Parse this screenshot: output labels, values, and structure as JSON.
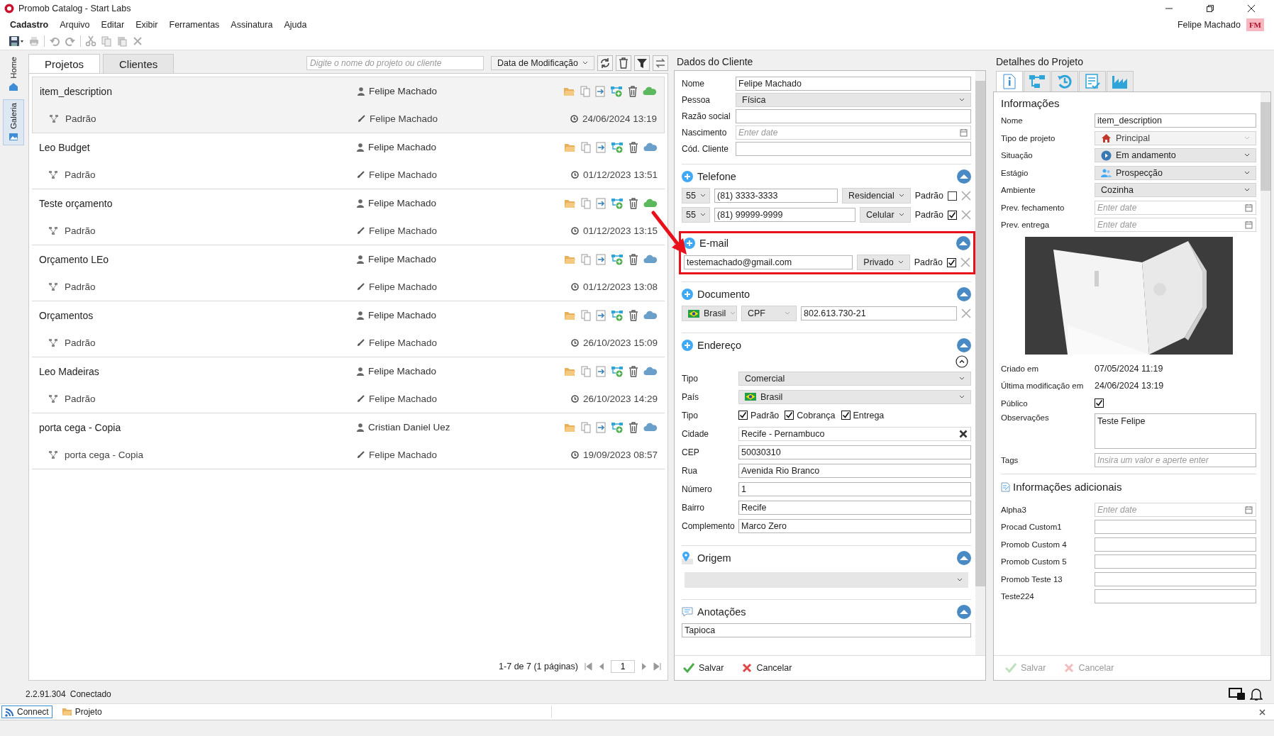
{
  "window": {
    "title": "Promob Catalog - Start Labs"
  },
  "menu": [
    {
      "label": "Cadastro",
      "selected": true
    },
    {
      "label": "Arquivo",
      "selected": false
    },
    {
      "label": "Editar",
      "selected": false
    },
    {
      "label": "Exibir",
      "selected": false
    },
    {
      "label": "Ferramentas",
      "selected": false
    },
    {
      "label": "Assinatura",
      "selected": false
    },
    {
      "label": "Ajuda",
      "selected": false
    }
  ],
  "user": {
    "name": "Felipe Machado",
    "initials": "FM"
  },
  "side_tabs": [
    {
      "label": "Home",
      "selected": false
    },
    {
      "label": "Galeria",
      "selected": true
    }
  ],
  "projects": {
    "tabs": [
      {
        "label": "Projetos",
        "selected": true
      },
      {
        "label": "Clientes",
        "selected": false
      }
    ],
    "search": {
      "placeholder": "Digite o nome do projeto ou cliente"
    },
    "sort": "Data de Modificação",
    "rows": [
      {
        "name": "item_description",
        "owner": "Felipe Machado",
        "version": "Padrão",
        "editor": "Felipe Machado",
        "date": "24/06/2024 13:19",
        "synced": true,
        "selected": true
      },
      {
        "name": "Leo Budget",
        "owner": "Felipe Machado",
        "version": "Padrão",
        "editor": "Felipe Machado",
        "date": "01/12/2023 13:51",
        "synced": false,
        "selected": false
      },
      {
        "name": "Teste orçamento",
        "owner": "Felipe Machado",
        "version": "Padrão",
        "editor": "Felipe Machado",
        "date": "01/12/2023 13:15",
        "synced": true,
        "selected": false
      },
      {
        "name": "Orçamento LEo",
        "owner": "Felipe Machado",
        "version": "Padrão",
        "editor": "Felipe Machado",
        "date": "01/12/2023 13:08",
        "synced": false,
        "selected": false
      },
      {
        "name": "Orçamentos",
        "owner": "Felipe Machado",
        "version": "Padrão",
        "editor": "Felipe Machado",
        "date": "26/10/2023 15:09",
        "synced": false,
        "selected": false
      },
      {
        "name": "Leo Madeiras",
        "owner": "Felipe Machado",
        "version": "Padrão",
        "editor": "Felipe Machado",
        "date": "26/10/2023 14:29",
        "synced": false,
        "selected": false
      },
      {
        "name": "porta cega - Copia",
        "owner": "Cristian Daniel Uez",
        "version": "porta cega - Copia",
        "editor": "Felipe Machado",
        "date": "19/09/2023 08:57",
        "synced": false,
        "selected": false
      }
    ],
    "pagination": {
      "summary": "1-7 de 7 (1 páginas)",
      "page": "1"
    }
  },
  "client": {
    "title": "Dados do Cliente",
    "fields": [
      {
        "label": "Nome",
        "kind": "text",
        "value": "Felipe Machado"
      },
      {
        "label": "Pessoa",
        "kind": "select",
        "value": "Física"
      },
      {
        "label": "Razão social",
        "kind": "text"
      },
      {
        "label": "Nascimento",
        "kind": "date",
        "placeholder": "Enter date"
      },
      {
        "label": "Cód. Cliente",
        "kind": "text"
      }
    ],
    "phone": {
      "title": "Telefone",
      "items": [
        {
          "code": "55",
          "number": "(81) 3333-3333",
          "type": "Residencial",
          "default_label": "Padrão",
          "checked": false
        },
        {
          "code": "55",
          "number": "(81) 99999-9999",
          "type": "Celular",
          "default_label": "Padrão",
          "checked": true
        }
      ]
    },
    "email": {
      "title": "E-mail",
      "highlighted": true,
      "items": [
        {
          "address": "testemachado@gmail.com",
          "type": "Privado",
          "default_label": "Padrão",
          "checked": true
        }
      ]
    },
    "document": {
      "title": "Documento",
      "country": "Brasil",
      "type": "CPF",
      "number": "802.613.730-21"
    },
    "address": {
      "title": "Endereço",
      "fields": [
        {
          "label": "Tipo",
          "kind": "select",
          "value": "Comercial"
        },
        {
          "label": "País",
          "kind": "country",
          "value": "Brasil"
        },
        {
          "label": "Tipo",
          "kind": "checks",
          "options": [
            {
              "label": "Padrão",
              "checked": true
            },
            {
              "label": "Cobrança",
              "checked": true
            },
            {
              "label": "Entrega",
              "checked": true
            }
          ]
        },
        {
          "label": "Cidade",
          "kind": "clearable",
          "value": "Recife - Pernambuco"
        },
        {
          "label": "CEP",
          "kind": "text",
          "value": "50030310"
        },
        {
          "label": "Rua",
          "kind": "text",
          "value": "Avenida Rio Branco"
        },
        {
          "label": "Número",
          "kind": "text",
          "value": "1"
        },
        {
          "label": "Bairro",
          "kind": "text",
          "value": "Recife"
        },
        {
          "label": "Complemento",
          "kind": "text",
          "value": "Marco Zero"
        }
      ]
    },
    "origin": {
      "title": "Origem"
    },
    "notes": {
      "title": "Anotações",
      "value": "Tapioca"
    },
    "actions": [
      {
        "label": "Salvar",
        "kind": "save",
        "disabled": false
      },
      {
        "label": "Cancelar",
        "kind": "cancel",
        "disabled": false
      }
    ]
  },
  "details": {
    "title": "Detalhes do Projeto",
    "tabs": [
      {
        "kind": "info",
        "selected": true
      },
      {
        "kind": "tree",
        "selected": false
      },
      {
        "kind": "history",
        "selected": false
      },
      {
        "kind": "checklist",
        "selected": false
      },
      {
        "kind": "chart",
        "selected": false
      }
    ],
    "section": "Informações",
    "fields": [
      {
        "label": "Nome",
        "kind": "text",
        "value": "item_description"
      },
      {
        "label": "Tipo de projeto",
        "kind": "select",
        "value": "Principal",
        "disabled": true
      },
      {
        "label": "Situação",
        "kind": "select",
        "value": "Em andamento",
        "disabled": false
      },
      {
        "label": "Estágio",
        "kind": "select",
        "value": "Prospecção",
        "disabled": false
      },
      {
        "label": "Ambiente",
        "kind": "select",
        "value": "Cozinha",
        "disabled": false
      },
      {
        "label": "Prev. fechamento",
        "kind": "date",
        "placeholder": "Enter date"
      },
      {
        "label": "Prev. entrega",
        "kind": "date",
        "placeholder": "Enter date"
      }
    ],
    "meta": [
      {
        "label": "Criado em",
        "value": "07/05/2024 11:19"
      },
      {
        "label": "Última modificação em",
        "value": "24/06/2024 13:19"
      }
    ],
    "public": {
      "label": "Público",
      "checked": true
    },
    "observations": {
      "label": "Observações",
      "value": "Teste Felipe"
    },
    "tags": {
      "label": "Tags",
      "placeholder": "Insira um valor e aperte enter"
    },
    "extra": {
      "title": "Informações adicionais",
      "fields": [
        {
          "label": "Alpha3",
          "kind": "date",
          "placeholder": "Enter date"
        },
        {
          "label": "Procad Custom1",
          "kind": "text"
        },
        {
          "label": "Promob Custom 4",
          "kind": "text"
        },
        {
          "label": "Promob Custom 5",
          "kind": "text"
        },
        {
          "label": "Promob Teste 13",
          "kind": "text"
        },
        {
          "label": "Teste224",
          "kind": "text"
        }
      ]
    },
    "actions": [
      {
        "label": "Salvar",
        "kind": "save",
        "disabled": true
      },
      {
        "label": "Cancelar",
        "kind": "cancel",
        "disabled": true
      }
    ]
  },
  "status": {
    "version": "2.2.91.304",
    "connection": "Conectado"
  },
  "bottom_tabs": [
    {
      "label": "Connect",
      "selected": true
    },
    {
      "label": "Projeto",
      "selected": false
    }
  ]
}
